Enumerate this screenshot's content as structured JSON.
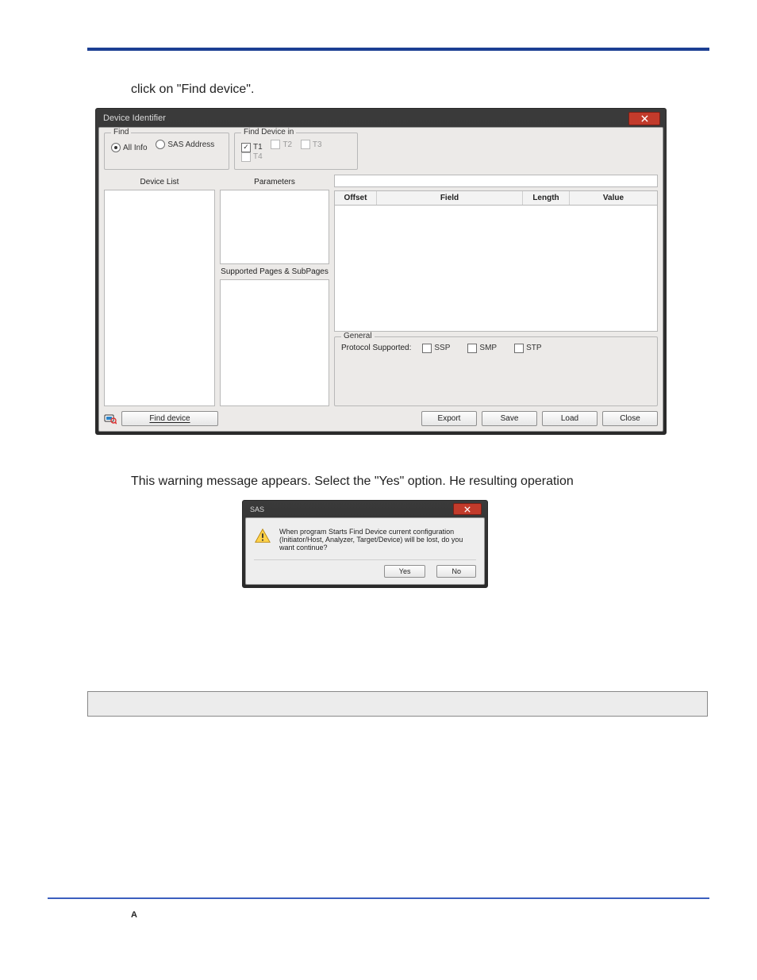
{
  "doc": {
    "line1": "click on \"Find device\".",
    "line2": "This warning message appears. Select the \"Yes\" option. He resulting operation",
    "footer": "A"
  },
  "dlg": {
    "title": "Device Identifier",
    "find_group": "Find",
    "find_all": "All Info",
    "find_sas": "SAS Address",
    "find_dev_in_group": "Find Device in",
    "t1": "T1",
    "t2": "T2",
    "t3": "T3",
    "t4": "T4",
    "device_list": "Device List",
    "parameters": "Parameters",
    "supported": "Supported Pages & SubPages",
    "cols": {
      "offset": "Offset",
      "field": "Field",
      "length": "Length",
      "value": "Value"
    },
    "general_group": "General",
    "proto_label": "Protocol Supported:",
    "ssp": "SSP",
    "smp": "SMP",
    "stp": "STP",
    "find_device_btn": "Find device",
    "export": "Export",
    "save": "Save",
    "load": "Load",
    "close": "Close"
  },
  "warn": {
    "title": "SAS",
    "msg": "When program Starts Find Device current configuration (Initiator/Host, Analyzer, Target/Device) will be lost, do you want continue?",
    "yes": "Yes",
    "no": "No"
  }
}
